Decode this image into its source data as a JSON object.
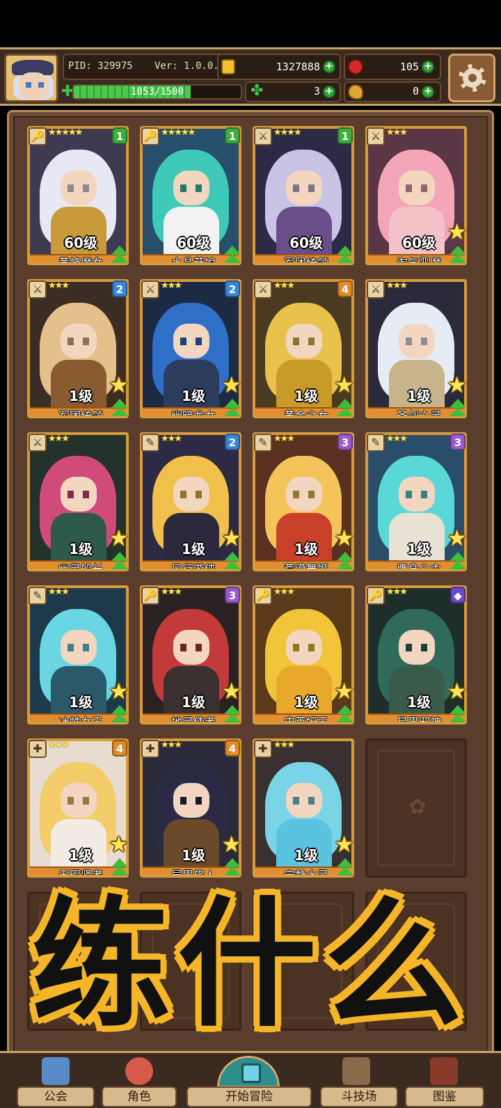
{
  "hud": {
    "pid_label": "PID: 329975",
    "version_label": "Ver: 1.0.0.5",
    "gold": "1327888",
    "ruby": "105",
    "clover": "3",
    "food": "0",
    "xp_text": "1053/1500",
    "xp_progress": 0.702
  },
  "cards": [
    {
      "name": "黄蜂魔女",
      "level": "60级",
      "stars": "★★★★★",
      "rank": "1",
      "rank_color": "#3fae3f",
      "big_star": false,
      "weapon": "🔑",
      "palette": {
        "bg": "#3d3a52",
        "hair": "#e8e8f4",
        "body": "#c89a3a"
      }
    },
    {
      "name": "水晶菇娘",
      "level": "60级",
      "stars": "★★★★★",
      "rank": "1",
      "rank_color": "#3fae3f",
      "big_star": false,
      "weapon": "🔑",
      "palette": {
        "bg": "#274e6a",
        "hair": "#3fc9b8",
        "body": "#f2f2f2"
      }
    },
    {
      "name": "军团统领",
      "level": "60级",
      "stars": "★★★★",
      "rank": "1",
      "rank_color": "#3fae3f",
      "big_star": false,
      "weapon": "⚔",
      "palette": {
        "bg": "#2c2a44",
        "hair": "#c9c4e6",
        "body": "#6a4e8a"
      }
    },
    {
      "name": "淘气恶魔",
      "level": "60级",
      "stars": "★★★",
      "rank": "",
      "rank_color": "",
      "big_star": true,
      "weapon": "⚔",
      "palette": {
        "bg": "#5a3646",
        "hair": "#f2a6b8",
        "body": "#f3c2c6"
      }
    },
    {
      "name": "军团统领",
      "level": "1级",
      "stars": "★★★",
      "rank": "2",
      "rank_color": "#3a86d8",
      "big_star": true,
      "weapon": "⚔",
      "palette": {
        "bg": "#3b2c24",
        "hair": "#e4c08a",
        "body": "#8a5a30"
      }
    },
    {
      "name": "幽暗龙女",
      "level": "1级",
      "stars": "★★★",
      "rank": "2",
      "rank_color": "#3a86d8",
      "big_star": true,
      "weapon": "⚔",
      "palette": {
        "bg": "#1d2a44",
        "hair": "#2f6fc8",
        "body": "#2c3c5c"
      }
    },
    {
      "name": "黄金之女",
      "level": "1级",
      "stars": "★★★",
      "rank": "4",
      "rank_color": "#e08a2a",
      "big_star": true,
      "weapon": "⚔",
      "palette": {
        "bg": "#4a3a22",
        "hair": "#e8c24a",
        "body": "#c89a28"
      }
    },
    {
      "name": "圣剑之灵",
      "level": "1级",
      "stars": "★★★",
      "rank": "",
      "rank_color": "",
      "big_star": true,
      "weapon": "⚔",
      "palette": {
        "bg": "#2a2a3a",
        "hair": "#e6ecf4",
        "body": "#c8b48a"
      }
    },
    {
      "name": "幽灵船长",
      "level": "1级",
      "stars": "★★★",
      "rank": "",
      "rank_color": "",
      "big_star": true,
      "weapon": "⚔",
      "palette": {
        "bg": "#23322a",
        "hair": "#d04a7a",
        "body": "#2f5a4a"
      }
    },
    {
      "name": "风行游侠",
      "level": "1级",
      "stars": "★★★",
      "rank": "2",
      "rank_color": "#3a86d8",
      "big_star": true,
      "weapon": "✎",
      "palette": {
        "bg": "#2c2a44",
        "hair": "#f0c04a",
        "body": "#2a2a3c"
      }
    },
    {
      "name": "荒漠舞姬",
      "level": "1级",
      "stars": "★★★",
      "rank": "3",
      "rank_color": "#9a5ad0",
      "big_star": true,
      "weapon": "✎",
      "palette": {
        "bg": "#5a3020",
        "hair": "#f4c45a",
        "body": "#c8402a"
      }
    },
    {
      "name": "鹰身公主",
      "level": "1级",
      "stars": "★★★",
      "rank": "3",
      "rank_color": "#9a5ad0",
      "big_star": true,
      "weapon": "✎",
      "palette": {
        "bg": "#2a4e6a",
        "hair": "#5ad8d8",
        "body": "#e8e2d4"
      }
    },
    {
      "name": "冰蛛女王",
      "level": "1级",
      "stars": "★★★",
      "rank": "",
      "rank_color": "",
      "big_star": true,
      "weapon": "✎",
      "palette": {
        "bg": "#1e3a4a",
        "hair": "#6ad6e4",
        "body": "#2a5a6a"
      }
    },
    {
      "name": "地灵使者",
      "level": "1级",
      "stars": "★★★",
      "rank": "3",
      "rank_color": "#9a5ad0",
      "big_star": true,
      "weapon": "🔑",
      "palette": {
        "bg": "#2a2222",
        "hair": "#c23a3a",
        "body": "#3a3030"
      }
    },
    {
      "name": "史莱姆王",
      "level": "1级",
      "stars": "★★★",
      "rank": "",
      "rank_color": "",
      "big_star": true,
      "weapon": "🔑",
      "palette": {
        "bg": "#5a3a1a",
        "hair": "#f2c43a",
        "body": "#e8a82a"
      }
    },
    {
      "name": "星界邪神",
      "level": "1级",
      "stars": "★★★",
      "rank": "◆",
      "rank_color": "#6a4ad0",
      "big_star": true,
      "weapon": "🔑",
      "palette": {
        "bg": "#1e2e2a",
        "hair": "#2f6a5a",
        "body": "#3a5a4a"
      }
    },
    {
      "name": "无瑕贤者",
      "level": "1级",
      "stars": "★★★",
      "rank": "4",
      "rank_color": "#e08a2a",
      "big_star": true,
      "weapon": "✚",
      "palette": {
        "bg": "#e8dcd0",
        "hair": "#f4cc6a",
        "body": "#f2ece4"
      }
    },
    {
      "name": "异界旅人",
      "level": "1级",
      "stars": "★★★",
      "rank": "4",
      "rank_color": "#e08a2a",
      "big_star": true,
      "weapon": "✚",
      "palette": {
        "bg": "#2a2a3a",
        "hair": "#2a2a44",
        "body": "#6a4a2a"
      }
    },
    {
      "name": "宁静水灵",
      "level": "1级",
      "stars": "★★★",
      "rank": "",
      "rank_color": "",
      "big_star": true,
      "weapon": "✚",
      "palette": {
        "bg": "#3a3030",
        "hair": "#7ad4e8",
        "body": "#5ac4e0"
      }
    }
  ],
  "empty_slot_icon": "paw-icon",
  "overlay_text": "练什么",
  "bottom_nav": [
    {
      "label": "公会",
      "icon": "guild-icon"
    },
    {
      "label": "角色",
      "icon": "character-icon"
    },
    {
      "label": "开始冒险",
      "icon": "adventure-icon"
    },
    {
      "label": "斗技场",
      "icon": "arena-icon"
    },
    {
      "label": "图鉴",
      "icon": "codex-icon"
    }
  ]
}
